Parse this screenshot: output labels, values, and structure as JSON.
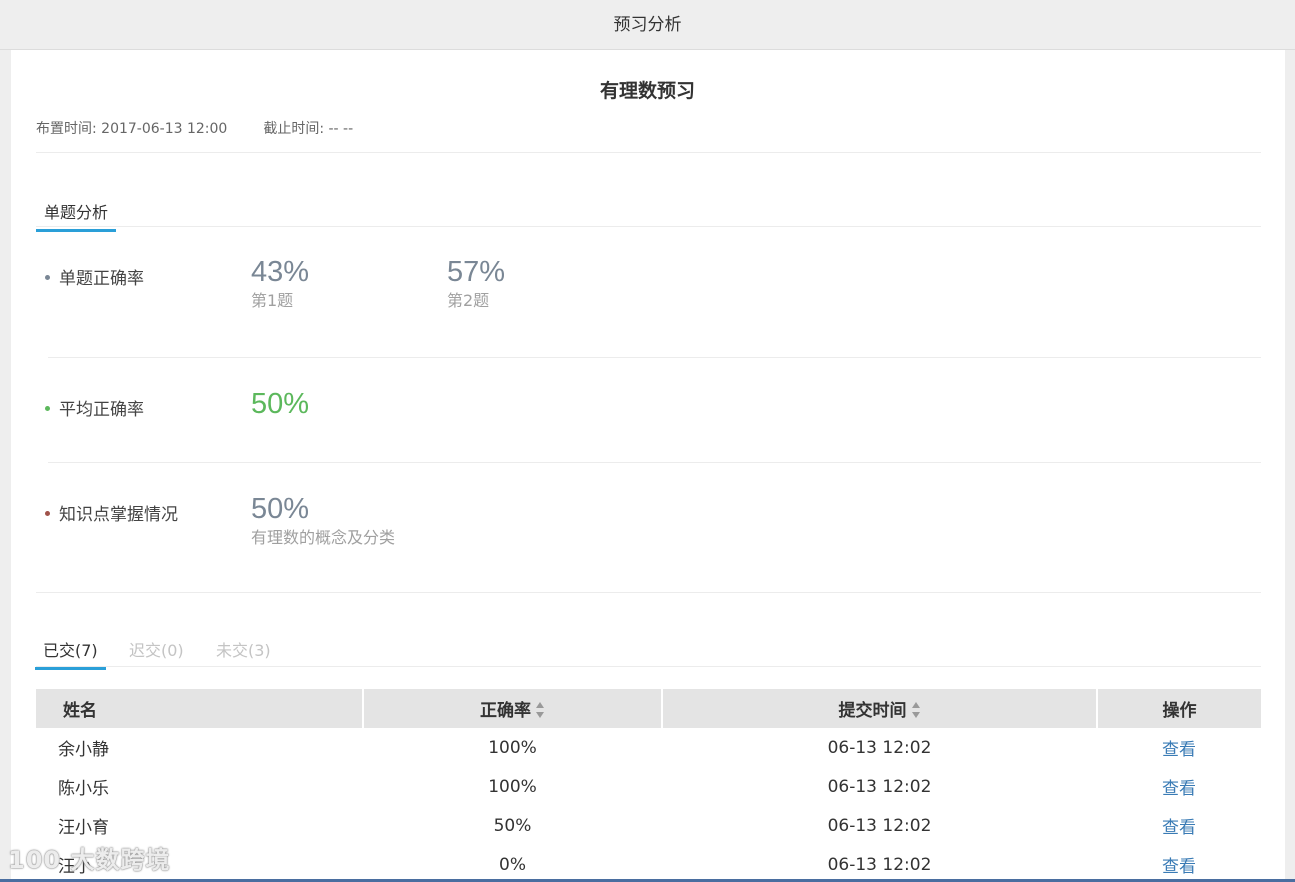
{
  "window": {
    "title": "预习分析"
  },
  "homework": {
    "title": "有理数预习",
    "assign_label": "布置时间: 2017-06-13 12:00",
    "deadline_label": "截止时间: -- --"
  },
  "analysis_tab": {
    "label": "单题分析"
  },
  "question_accuracy": {
    "label": "单题正确率",
    "items": [
      {
        "pct": "43%",
        "name": "第1题"
      },
      {
        "pct": "57%",
        "name": "第2题"
      }
    ]
  },
  "average_accuracy": {
    "label": "平均正确率",
    "pct": "50%"
  },
  "knowledge": {
    "label": "知识点掌握情况",
    "pct": "50%",
    "name": "有理数的概念及分类"
  },
  "submission_tabs": [
    {
      "label": "已交(7)"
    },
    {
      "label": "迟交(0)"
    },
    {
      "label": "未交(3)"
    }
  ],
  "table": {
    "headers": {
      "name": "姓名",
      "accuracy": "正确率",
      "time": "提交时间",
      "action": "操作"
    },
    "rows": [
      {
        "name": "余小静",
        "accuracy": "100%",
        "time": "06-13 12:02",
        "action": "查看"
      },
      {
        "name": "陈小乐",
        "accuracy": "100%",
        "time": "06-13 12:02",
        "action": "查看"
      },
      {
        "name": "汪小育",
        "accuracy": "50%",
        "time": "06-13 12:02",
        "action": "查看"
      },
      {
        "name": "汪小",
        "accuracy": "0%",
        "time": "06-13 12:02",
        "action": "查看"
      }
    ]
  },
  "watermark": {
    "text": "100 大数跨境"
  },
  "colors": {
    "accent": "#2a9fd8",
    "green": "#5cb85c",
    "link": "#3a7bb5",
    "dot_question": "#7a8795",
    "dot_average": "#5cb85c",
    "dot_knowledge": "#a0524a"
  }
}
